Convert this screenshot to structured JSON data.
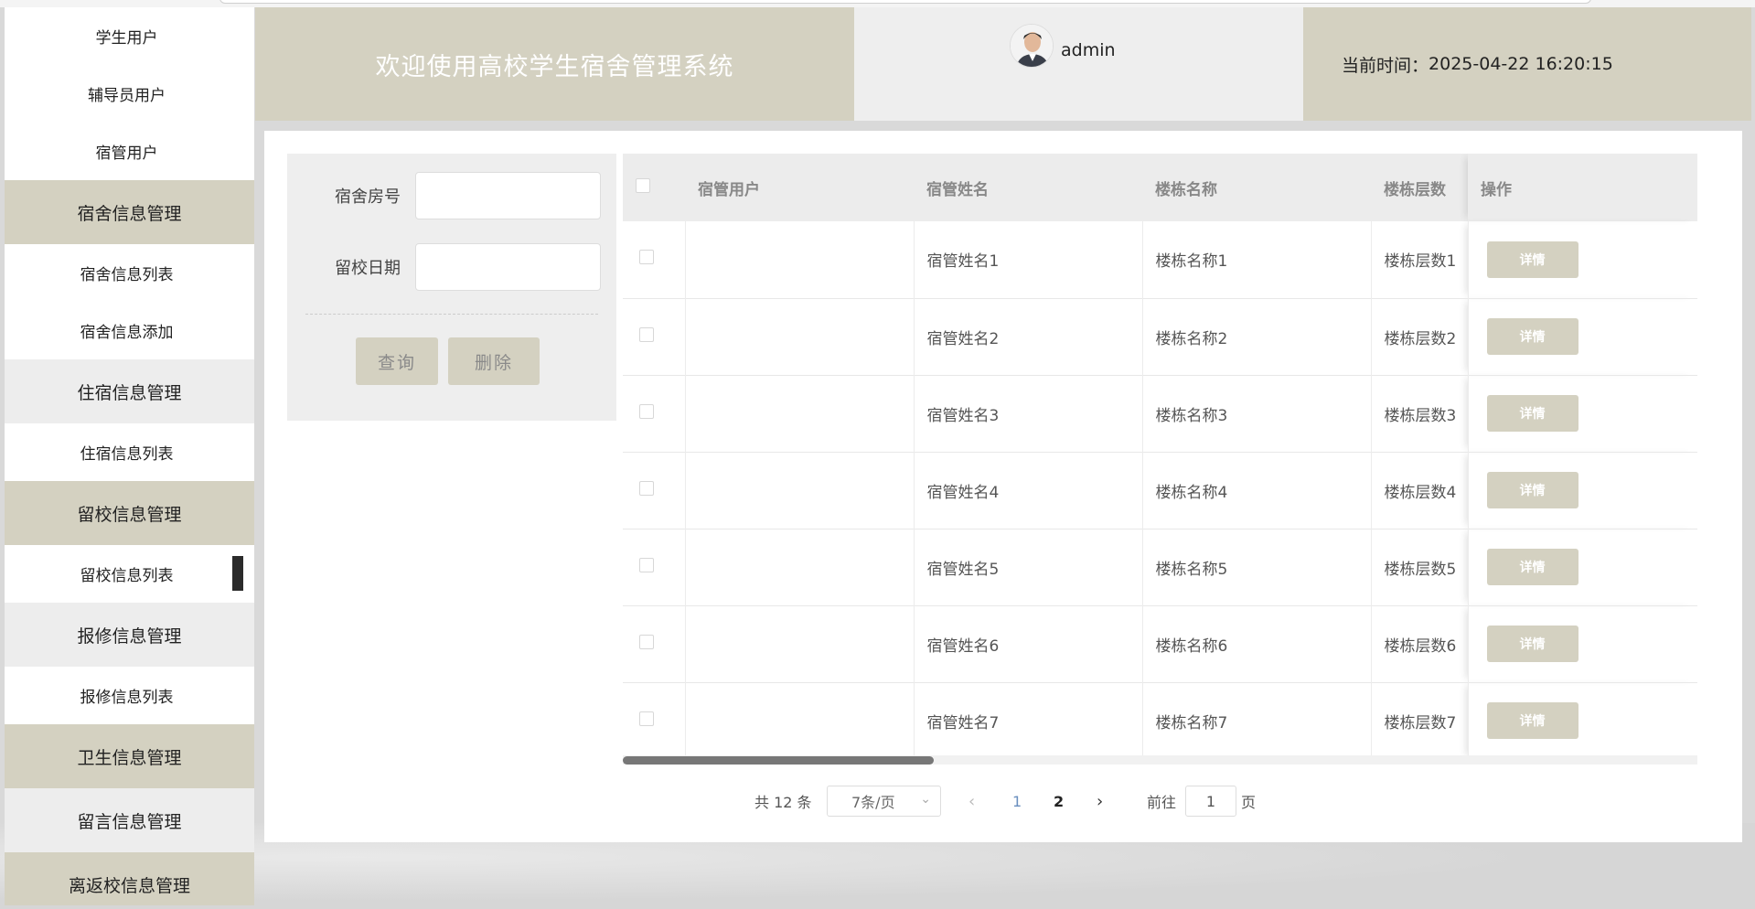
{
  "sidebar": {
    "items": [
      {
        "label": "学生用户",
        "type": "item"
      },
      {
        "label": "辅导员用户",
        "type": "item"
      },
      {
        "label": "宿管用户",
        "type": "item"
      },
      {
        "label": "宿舍信息管理",
        "type": "group",
        "style": "tan"
      },
      {
        "label": "宿舍信息列表",
        "type": "item"
      },
      {
        "label": "宿舍信息添加",
        "type": "item"
      },
      {
        "label": "住宿信息管理",
        "type": "group",
        "style": "grey"
      },
      {
        "label": "住宿信息列表",
        "type": "item"
      },
      {
        "label": "留校信息管理",
        "type": "group",
        "style": "tan"
      },
      {
        "label": "留校信息列表",
        "type": "item",
        "active": true
      },
      {
        "label": "报修信息管理",
        "type": "group",
        "style": "grey"
      },
      {
        "label": "报修信息列表",
        "type": "item"
      },
      {
        "label": "卫生信息管理",
        "type": "group",
        "style": "tan"
      },
      {
        "label": "留言信息管理",
        "type": "group",
        "style": "grey"
      },
      {
        "label": "离返校信息管理",
        "type": "group",
        "style": "tan"
      }
    ]
  },
  "header": {
    "title": "欢迎使用高校学生宿舍管理系统",
    "username": "admin",
    "time_label": "当前时间：",
    "time_value": "2025-04-22 16:20:15"
  },
  "search": {
    "room_label": "宿舍房号",
    "room_value": "",
    "date_label": "留校日期",
    "date_value": "",
    "query_label": "查询",
    "delete_label": "删除"
  },
  "table": {
    "columns": [
      "宿管用户",
      "宿管姓名",
      "楼栋名称",
      "楼栋层数",
      "操作"
    ],
    "detail_label": "详情",
    "rows": [
      {
        "user": "",
        "name": "宿管姓名1",
        "building": "楼栋名称1",
        "floor": "楼栋层数1"
      },
      {
        "user": "",
        "name": "宿管姓名2",
        "building": "楼栋名称2",
        "floor": "楼栋层数2"
      },
      {
        "user": "",
        "name": "宿管姓名3",
        "building": "楼栋名称3",
        "floor": "楼栋层数3"
      },
      {
        "user": "",
        "name": "宿管姓名4",
        "building": "楼栋名称4",
        "floor": "楼栋层数4"
      },
      {
        "user": "",
        "name": "宿管姓名5",
        "building": "楼栋名称5",
        "floor": "楼栋层数5"
      },
      {
        "user": "",
        "name": "宿管姓名6",
        "building": "楼栋名称6",
        "floor": "楼栋层数6"
      },
      {
        "user": "",
        "name": "宿管姓名7",
        "building": "楼栋名称7",
        "floor": "楼栋层数7"
      }
    ]
  },
  "pager": {
    "total": "共 12 条",
    "page_size": "7条/页",
    "pages": [
      "1",
      "2"
    ],
    "goto_label": "前往",
    "goto_value": "1",
    "page_suffix": "页"
  },
  "colors": {
    "accent": "#d4d1c1",
    "grey_band": "#ededed"
  }
}
